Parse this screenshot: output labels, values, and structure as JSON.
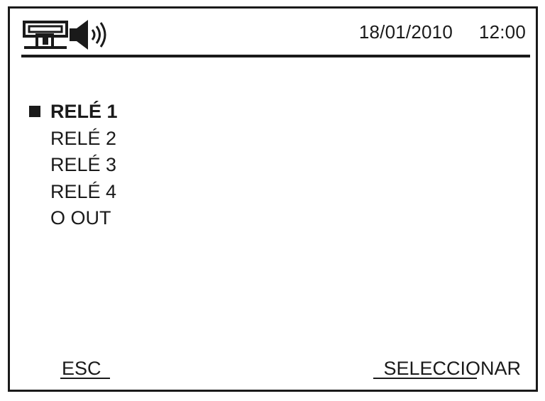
{
  "status_bar": {
    "icons": [
      "network-icon",
      "speaker-icon"
    ],
    "date": "18/01/2010",
    "time": "12:00"
  },
  "menu": {
    "items": [
      {
        "label": "RELÉ 1",
        "selected": true
      },
      {
        "label": "RELÉ 2",
        "selected": false
      },
      {
        "label": "RELÉ 3",
        "selected": false
      },
      {
        "label": "RELÉ 4",
        "selected": false
      },
      {
        "label": "O OUT",
        "selected": false
      }
    ]
  },
  "softkeys": {
    "left_label": "ESC",
    "right_label": "SELECCIONAR"
  },
  "colors": {
    "foreground": "#1a1a1a",
    "background": "#ffffff"
  }
}
